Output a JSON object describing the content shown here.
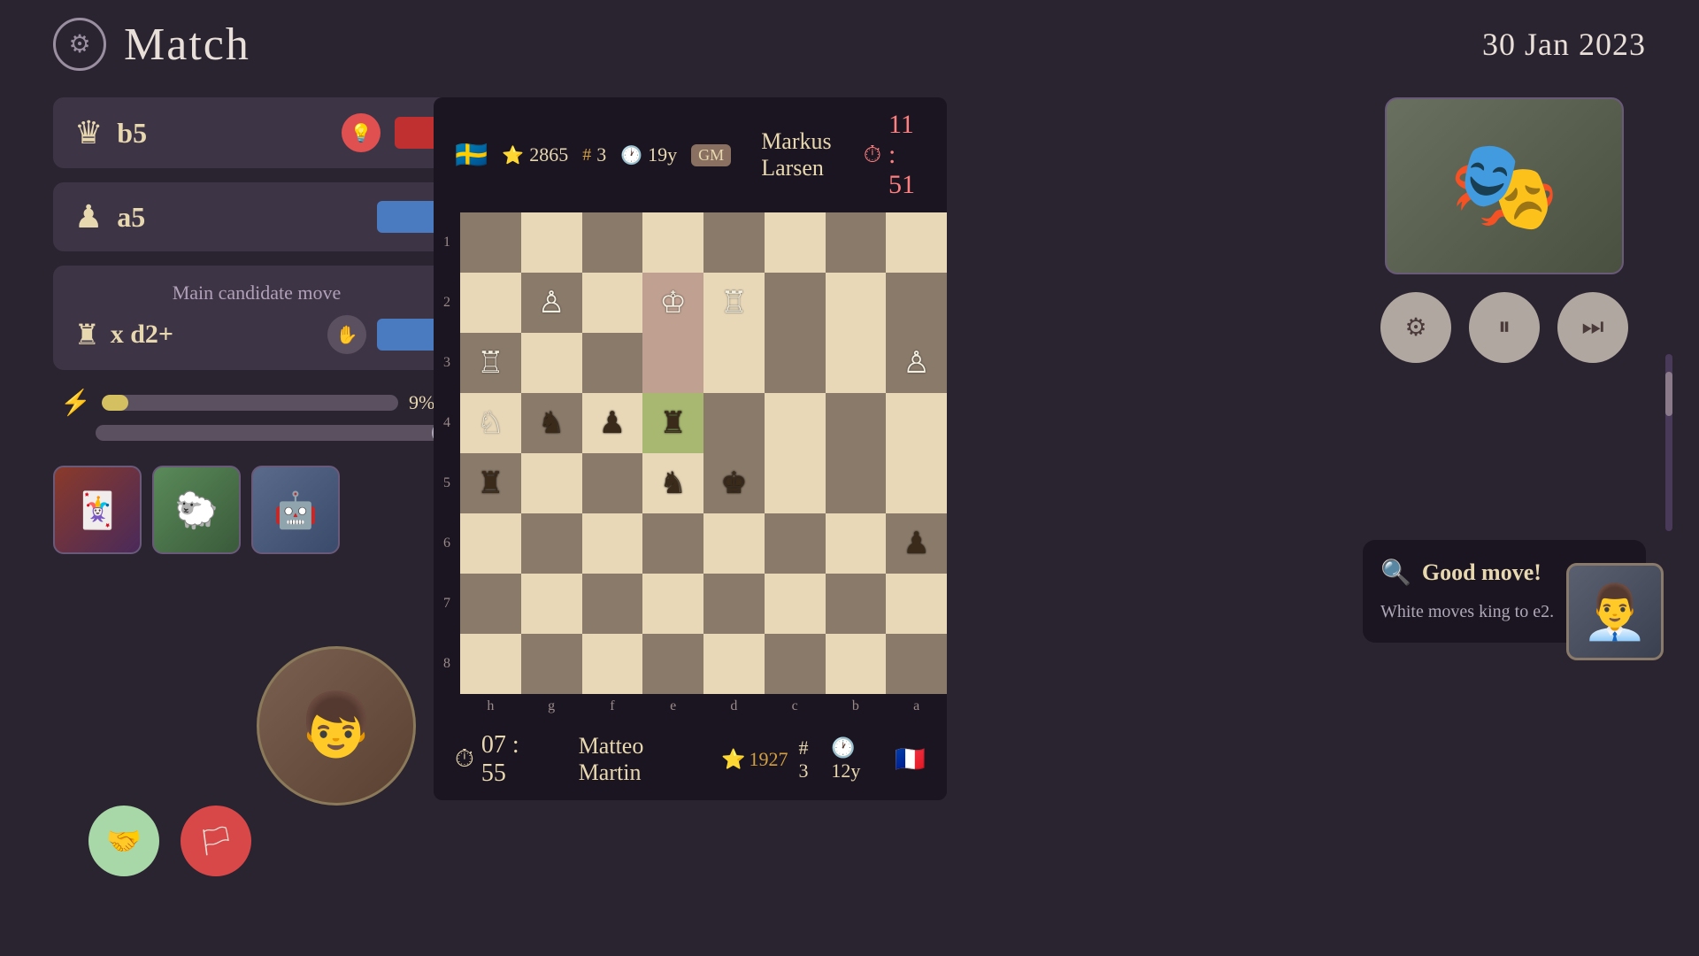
{
  "header": {
    "title": "Match",
    "date": "30 Jan 2023",
    "gear_label": "⚙"
  },
  "top_player": {
    "flag": "🇸🇪",
    "rating": "2865",
    "stars": "3",
    "age": "19y",
    "gm_badge": "GM",
    "name": "Markus Larsen",
    "timer": "11 : 51"
  },
  "bottom_player": {
    "name": "Matteo Martin",
    "rating": "1927",
    "stars": "3",
    "age": "12y",
    "flag": "🇫🇷",
    "timer": "07 : 55"
  },
  "move_card1": {
    "piece": "♛",
    "move": "b5"
  },
  "move_card2": {
    "piece": "♟",
    "move": "a5"
  },
  "candidate": {
    "label": "Main candidate move",
    "piece": "♜",
    "move": "x d2+"
  },
  "progress": {
    "pct": "9%"
  },
  "comment": {
    "title": "Good move!",
    "text": "White moves king to e2."
  },
  "controls": {
    "settings_icon": "⚙",
    "pause_icon": "⏸",
    "skip_icon": "⏭"
  },
  "board": {
    "row_labels": [
      "1",
      "2",
      "3",
      "4",
      "5",
      "6",
      "7",
      "8"
    ],
    "col_labels": [
      "h",
      "g",
      "f",
      "e",
      "d",
      "c",
      "b",
      "a"
    ]
  }
}
